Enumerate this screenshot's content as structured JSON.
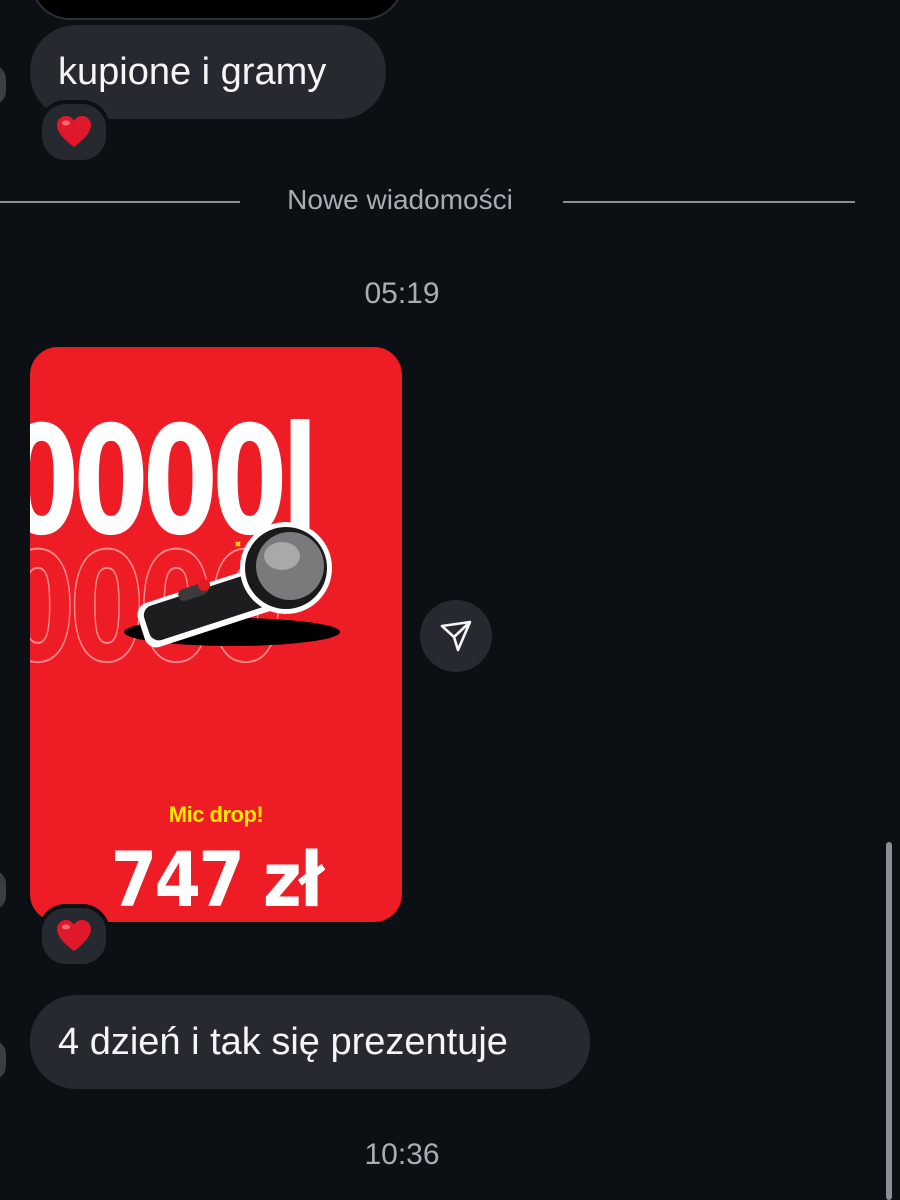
{
  "messages": {
    "first": "kupione i gramy",
    "second": "4 dzień i tak się prezentuje"
  },
  "divider": {
    "label": "Nowe wiadomości"
  },
  "timestamps": {
    "first": "05:19",
    "second": "10:36"
  },
  "card": {
    "headline": "0000l",
    "outline_text": "0000",
    "subtitle": "Mic drop!",
    "price": "747 zł"
  },
  "icons": {
    "reaction": "heart-icon",
    "share": "send-icon"
  },
  "colors": {
    "background": "#0c1014",
    "bubble": "#262a30",
    "card": "#ee1d25",
    "accent_yellow": "#ffe800",
    "heart": "#e0182b"
  }
}
